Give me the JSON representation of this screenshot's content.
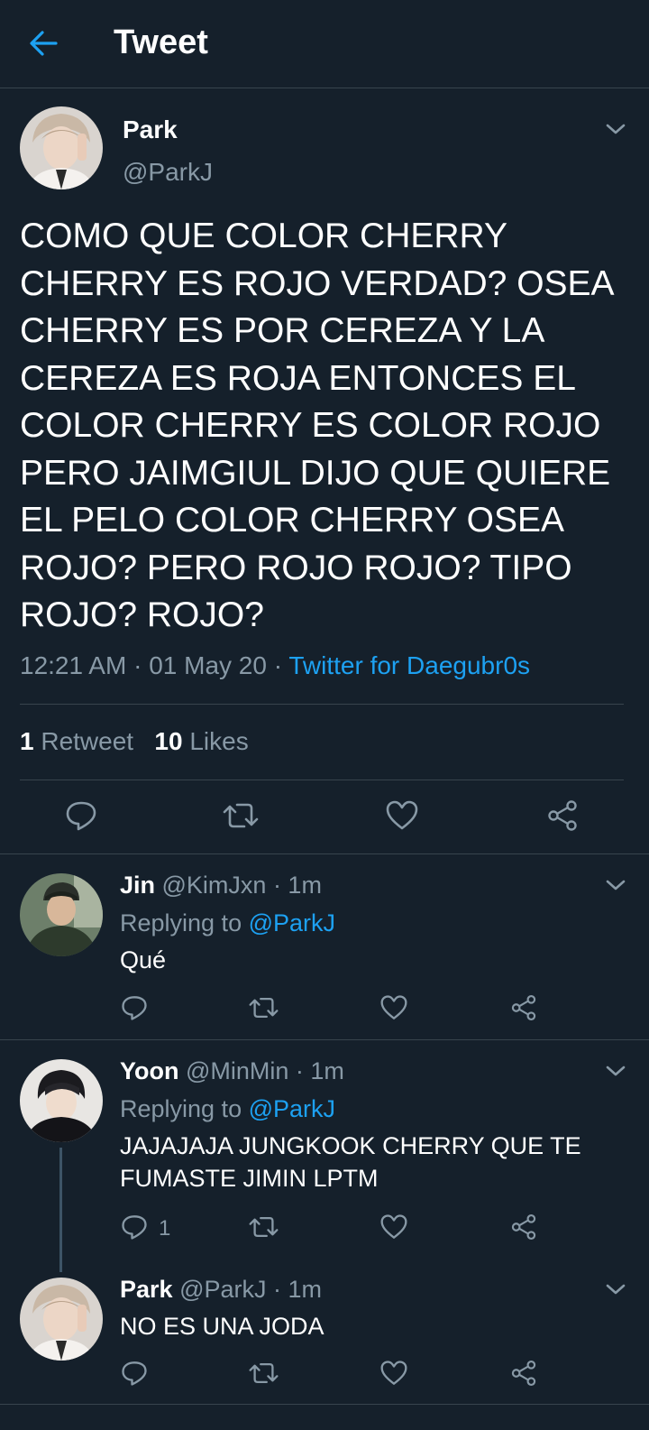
{
  "header": {
    "title": "Tweet"
  },
  "main_tweet": {
    "name": "Park",
    "handle": "@ParkJ",
    "text": "COMO QUE COLOR CHERRY\nCHERRY ES ROJO VERDAD? OSEA\nCHERRY ES POR CEREZA Y LA\nCEREZA ES ROJA ENTONCES EL\nCOLOR CHERRY ES COLOR ROJO\nPERO JAIMGIUL DIJO QUE QUIERE\nEL PELO COLOR CHERRY OSEA\nROJO? PERO ROJO ROJO? TIPO\nROJO? ROJO?",
    "time": "12:21 AM",
    "sep1": " · ",
    "date": "01 May 20",
    "sep2": " · ",
    "source": "Twitter for Daegubr0s",
    "retweets": "1",
    "retweets_label": " Retweet",
    "likes": "10",
    "likes_label": " Likes"
  },
  "replies": [
    {
      "name": "Jin",
      "handle": " @KimJxn · 1m",
      "replying": "Replying to ",
      "replying_to": "@ParkJ",
      "text": "Qué",
      "reply_count": ""
    },
    {
      "name": "Yoon",
      "handle": " @MinMin · 1m",
      "replying": "Replying to ",
      "replying_to": "@ParkJ",
      "text": "JAJAJAJA JUNGKOOK CHERRY QUE TE\nFUMASTE JIMIN LPTM",
      "reply_count": "1"
    },
    {
      "name": "Park",
      "handle": " @ParkJ · 1m",
      "text": "NO ES UNA JODA"
    }
  ],
  "colors": {
    "background": "#15202b",
    "divider": "#38444d",
    "secondary_text": "#8899a6",
    "accent": "#1da1f2"
  },
  "icons": [
    "back-arrow-icon",
    "chevron-down-icon",
    "reply-icon",
    "retweet-icon",
    "like-icon",
    "share-icon"
  ]
}
